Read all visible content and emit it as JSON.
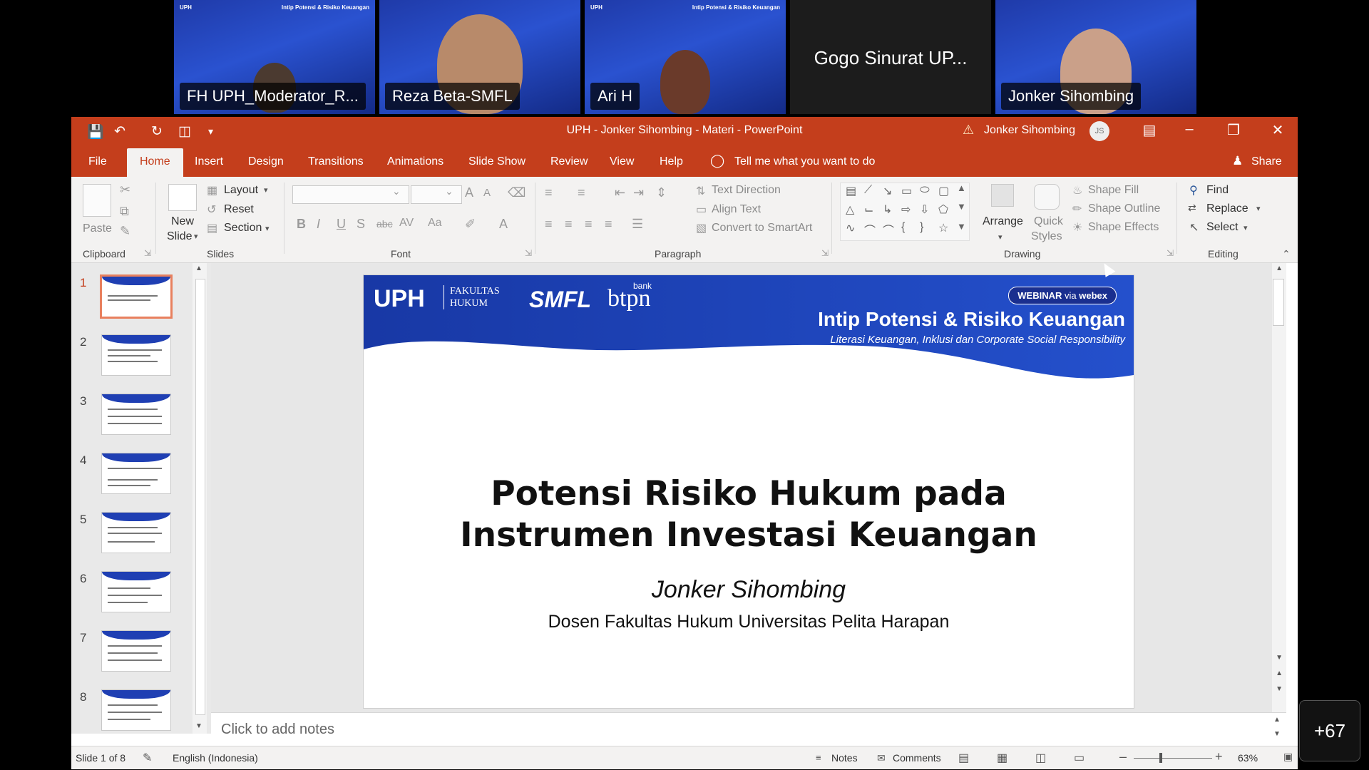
{
  "participants": [
    {
      "name": "FH UPH_Moderator_R...",
      "banner_left": "UPH",
      "banner_right": "Intip Potensi & Risiko Keuangan"
    },
    {
      "name": "Reza Beta-SMFL"
    },
    {
      "name": "Ari H",
      "banner_left": "UPH",
      "banner_right": "Intip Potensi & Risiko Keuangan"
    },
    {
      "name": "Gogo Sinurat UP...",
      "video_off": true
    },
    {
      "name": "Jonker Sihombing"
    }
  ],
  "more_participants": "+67",
  "window": {
    "title": "UPH - Jonker Sihombing - Materi  -  PowerPoint",
    "user": "Jonker Sihombing",
    "user_initials": "JS",
    "accent": "#c43e1c"
  },
  "menu": {
    "tabs": [
      "File",
      "Home",
      "Insert",
      "Design",
      "Transitions",
      "Animations",
      "Slide Show",
      "Review",
      "View",
      "Help"
    ],
    "active": "Home",
    "tell_me": "Tell me what you want to do",
    "share": "Share"
  },
  "ribbon": {
    "clipboard": {
      "label": "Clipboard",
      "paste": "Paste"
    },
    "slides": {
      "label": "Slides",
      "new_slide_1": "New",
      "new_slide_2": "Slide",
      "layout": "Layout",
      "reset": "Reset",
      "section": "Section"
    },
    "font": {
      "label": "Font"
    },
    "paragraph": {
      "label": "Paragraph",
      "text_direction": "Text Direction",
      "align_text": "Align Text",
      "convert_smartart": "Convert to SmartArt"
    },
    "drawing": {
      "label": "Drawing",
      "arrange": "Arrange",
      "quick_1": "Quick",
      "quick_2": "Styles",
      "shape_fill": "Shape Fill",
      "shape_outline": "Shape Outline",
      "shape_effects": "Shape Effects"
    },
    "editing": {
      "label": "Editing",
      "find": "Find",
      "replace": "Replace",
      "select": "Select"
    }
  },
  "thumbnails": [
    "1",
    "2",
    "3",
    "4",
    "5",
    "6",
    "7",
    "8"
  ],
  "selected_slide": 1,
  "slide": {
    "logo_uph": "UPH",
    "logo_fakultas_1": "FAKULTAS",
    "logo_fakultas_2": "HUKUM",
    "logo_smfl": "SMFL",
    "logo_bank": "bank",
    "logo_btpn": "btpn",
    "webinar": "WEBINAR",
    "webinar_via": "via",
    "webinar_brand": "webex",
    "banner_title": "Intip Potensi & Risiko Keuangan",
    "banner_subtitle": "Literasi Keuangan, Inklusi dan Corporate Social Responsibility",
    "title_line1": "Potensi Risiko Hukum pada",
    "title_line2": "Instrumen Investasi Keuangan",
    "author": "Jonker Sihombing",
    "affiliation": "Dosen Fakultas Hukum Universitas Pelita Harapan",
    "banner_color": "#1f3fb3"
  },
  "notes_placeholder": "Click to add notes",
  "status": {
    "slide_of": "Slide 1 of 8",
    "language": "English (Indonesia)",
    "notes": "Notes",
    "comments": "Comments",
    "zoom": "63%"
  }
}
